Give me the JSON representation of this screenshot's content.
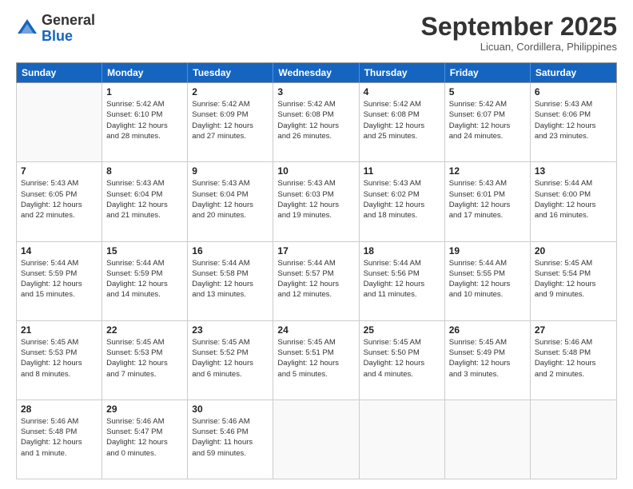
{
  "header": {
    "logo_general": "General",
    "logo_blue": "Blue",
    "month_title": "September 2025",
    "location": "Licuan, Cordillera, Philippines"
  },
  "days_of_week": [
    "Sunday",
    "Monday",
    "Tuesday",
    "Wednesday",
    "Thursday",
    "Friday",
    "Saturday"
  ],
  "weeks": [
    [
      {
        "day": "",
        "info": ""
      },
      {
        "day": "1",
        "info": "Sunrise: 5:42 AM\nSunset: 6:10 PM\nDaylight: 12 hours\nand 28 minutes."
      },
      {
        "day": "2",
        "info": "Sunrise: 5:42 AM\nSunset: 6:09 PM\nDaylight: 12 hours\nand 27 minutes."
      },
      {
        "day": "3",
        "info": "Sunrise: 5:42 AM\nSunset: 6:08 PM\nDaylight: 12 hours\nand 26 minutes."
      },
      {
        "day": "4",
        "info": "Sunrise: 5:42 AM\nSunset: 6:08 PM\nDaylight: 12 hours\nand 25 minutes."
      },
      {
        "day": "5",
        "info": "Sunrise: 5:42 AM\nSunset: 6:07 PM\nDaylight: 12 hours\nand 24 minutes."
      },
      {
        "day": "6",
        "info": "Sunrise: 5:43 AM\nSunset: 6:06 PM\nDaylight: 12 hours\nand 23 minutes."
      }
    ],
    [
      {
        "day": "7",
        "info": "Sunrise: 5:43 AM\nSunset: 6:05 PM\nDaylight: 12 hours\nand 22 minutes."
      },
      {
        "day": "8",
        "info": "Sunrise: 5:43 AM\nSunset: 6:04 PM\nDaylight: 12 hours\nand 21 minutes."
      },
      {
        "day": "9",
        "info": "Sunrise: 5:43 AM\nSunset: 6:04 PM\nDaylight: 12 hours\nand 20 minutes."
      },
      {
        "day": "10",
        "info": "Sunrise: 5:43 AM\nSunset: 6:03 PM\nDaylight: 12 hours\nand 19 minutes."
      },
      {
        "day": "11",
        "info": "Sunrise: 5:43 AM\nSunset: 6:02 PM\nDaylight: 12 hours\nand 18 minutes."
      },
      {
        "day": "12",
        "info": "Sunrise: 5:43 AM\nSunset: 6:01 PM\nDaylight: 12 hours\nand 17 minutes."
      },
      {
        "day": "13",
        "info": "Sunrise: 5:44 AM\nSunset: 6:00 PM\nDaylight: 12 hours\nand 16 minutes."
      }
    ],
    [
      {
        "day": "14",
        "info": "Sunrise: 5:44 AM\nSunset: 5:59 PM\nDaylight: 12 hours\nand 15 minutes."
      },
      {
        "day": "15",
        "info": "Sunrise: 5:44 AM\nSunset: 5:59 PM\nDaylight: 12 hours\nand 14 minutes."
      },
      {
        "day": "16",
        "info": "Sunrise: 5:44 AM\nSunset: 5:58 PM\nDaylight: 12 hours\nand 13 minutes."
      },
      {
        "day": "17",
        "info": "Sunrise: 5:44 AM\nSunset: 5:57 PM\nDaylight: 12 hours\nand 12 minutes."
      },
      {
        "day": "18",
        "info": "Sunrise: 5:44 AM\nSunset: 5:56 PM\nDaylight: 12 hours\nand 11 minutes."
      },
      {
        "day": "19",
        "info": "Sunrise: 5:44 AM\nSunset: 5:55 PM\nDaylight: 12 hours\nand 10 minutes."
      },
      {
        "day": "20",
        "info": "Sunrise: 5:45 AM\nSunset: 5:54 PM\nDaylight: 12 hours\nand 9 minutes."
      }
    ],
    [
      {
        "day": "21",
        "info": "Sunrise: 5:45 AM\nSunset: 5:53 PM\nDaylight: 12 hours\nand 8 minutes."
      },
      {
        "day": "22",
        "info": "Sunrise: 5:45 AM\nSunset: 5:53 PM\nDaylight: 12 hours\nand 7 minutes."
      },
      {
        "day": "23",
        "info": "Sunrise: 5:45 AM\nSunset: 5:52 PM\nDaylight: 12 hours\nand 6 minutes."
      },
      {
        "day": "24",
        "info": "Sunrise: 5:45 AM\nSunset: 5:51 PM\nDaylight: 12 hours\nand 5 minutes."
      },
      {
        "day": "25",
        "info": "Sunrise: 5:45 AM\nSunset: 5:50 PM\nDaylight: 12 hours\nand 4 minutes."
      },
      {
        "day": "26",
        "info": "Sunrise: 5:45 AM\nSunset: 5:49 PM\nDaylight: 12 hours\nand 3 minutes."
      },
      {
        "day": "27",
        "info": "Sunrise: 5:46 AM\nSunset: 5:48 PM\nDaylight: 12 hours\nand 2 minutes."
      }
    ],
    [
      {
        "day": "28",
        "info": "Sunrise: 5:46 AM\nSunset: 5:48 PM\nDaylight: 12 hours\nand 1 minute."
      },
      {
        "day": "29",
        "info": "Sunrise: 5:46 AM\nSunset: 5:47 PM\nDaylight: 12 hours\nand 0 minutes."
      },
      {
        "day": "30",
        "info": "Sunrise: 5:46 AM\nSunset: 5:46 PM\nDaylight: 11 hours\nand 59 minutes."
      },
      {
        "day": "",
        "info": ""
      },
      {
        "day": "",
        "info": ""
      },
      {
        "day": "",
        "info": ""
      },
      {
        "day": "",
        "info": ""
      }
    ]
  ]
}
